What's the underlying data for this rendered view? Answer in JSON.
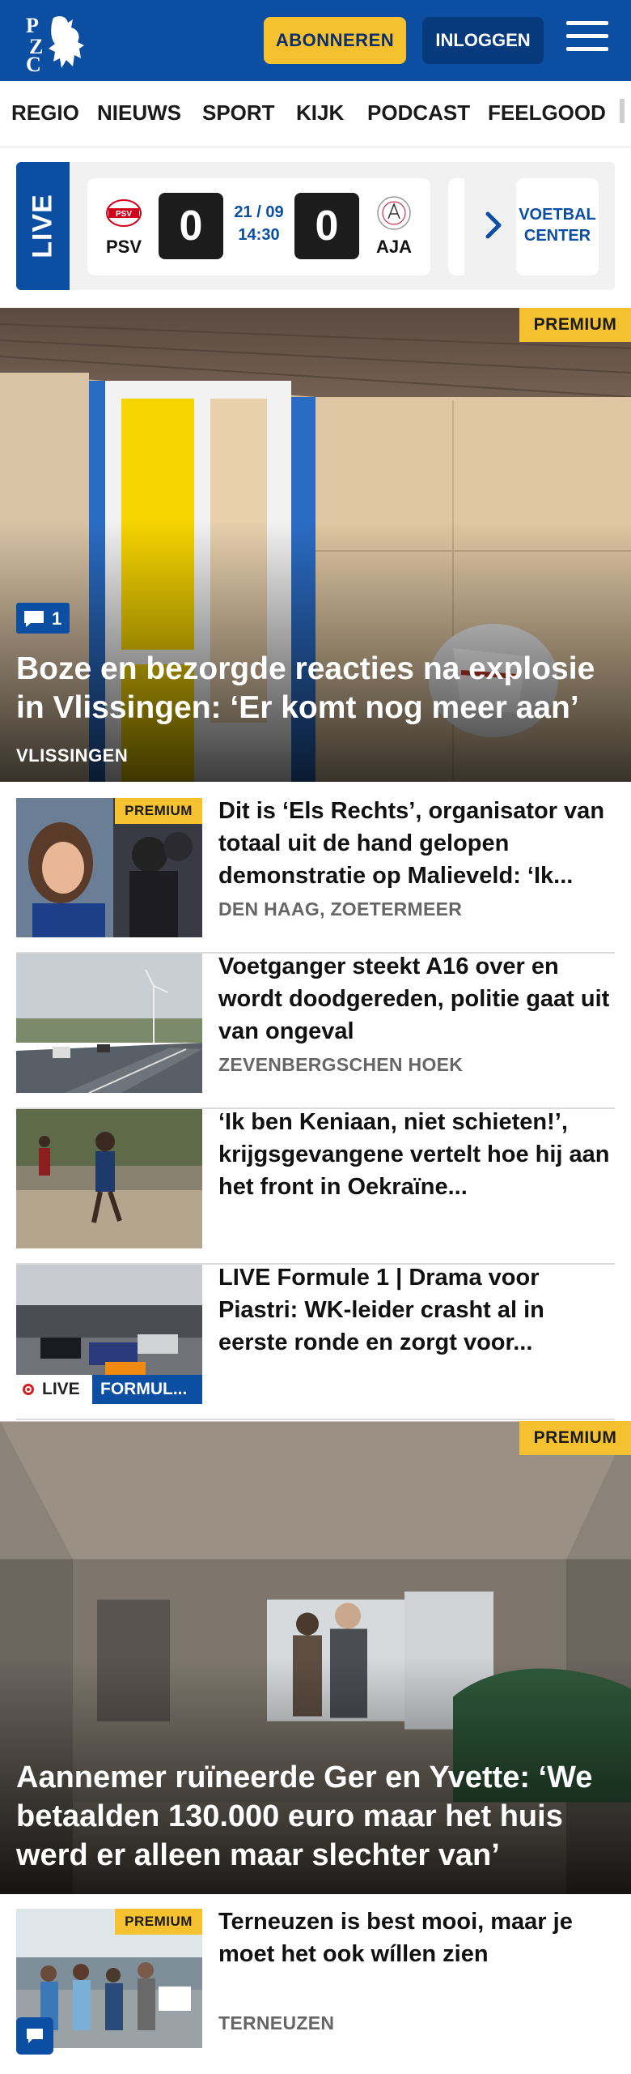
{
  "header": {
    "logo_letters": "PZC",
    "subscribe_label": "ABONNEREN",
    "login_label": "INLOGGEN",
    "menu_icon": "hamburger-menu-icon",
    "brand_color": "#0b4ea2",
    "accent_color": "#f5c12e"
  },
  "nav": {
    "items": [
      "REGIO",
      "NIEUWS",
      "SPORT",
      "KIJK",
      "PODCAST",
      "FEELGOOD"
    ]
  },
  "live_widget": {
    "tag": "LIVE",
    "home_team": "PSV",
    "away_team": "AJA",
    "home_score": "0",
    "away_score": "0",
    "date": "21 / 09",
    "time": "14:30",
    "voetbal_center_line1": "VOETBAL",
    "voetbal_center_line2": "CENTER"
  },
  "hero": {
    "badge": "PREMIUM",
    "comment_count": "1",
    "title": "Boze en bezorgde reacties na explosie in Vlissingen: ‘Er komt nog meer aan’",
    "location": "VLISSINGEN"
  },
  "articles": [
    {
      "badge": "PREMIUM",
      "title": "Dit is ‘Els Rechts’, organisator van totaal uit de hand gelopen demonstratie op Malieveld: ‘Ik...",
      "location": "DEN HAAG, ZOETERMEER"
    },
    {
      "title": "Voetganger steekt A16 over en wordt doodgereden, politie gaat uit van ongeval",
      "location": "ZEVENBERGSCHEN HOEK"
    },
    {
      "title": "‘Ik ben Keniaan, niet schieten!’, krijgsgevangene vertelt hoe hij aan het front in Oekraïne..."
    },
    {
      "title": "LIVE Formule 1 | Drama voor Piastri: WK-leider crasht al in eerste ronde en zorgt voor...",
      "live_label": "LIVE",
      "category": "FORMUL..."
    }
  ],
  "hero2": {
    "badge": "PREMIUM",
    "title": "Aannemer ruïneerde Ger en Yvette: ‘We betaalden 130.000 euro maar het huis werd er alleen maar slechter van’"
  },
  "articles2": [
    {
      "badge": "PREMIUM",
      "title": "Terneuzen is best mooi, maar je moet het ook wíllen zien",
      "location": "TERNEUZEN"
    }
  ]
}
